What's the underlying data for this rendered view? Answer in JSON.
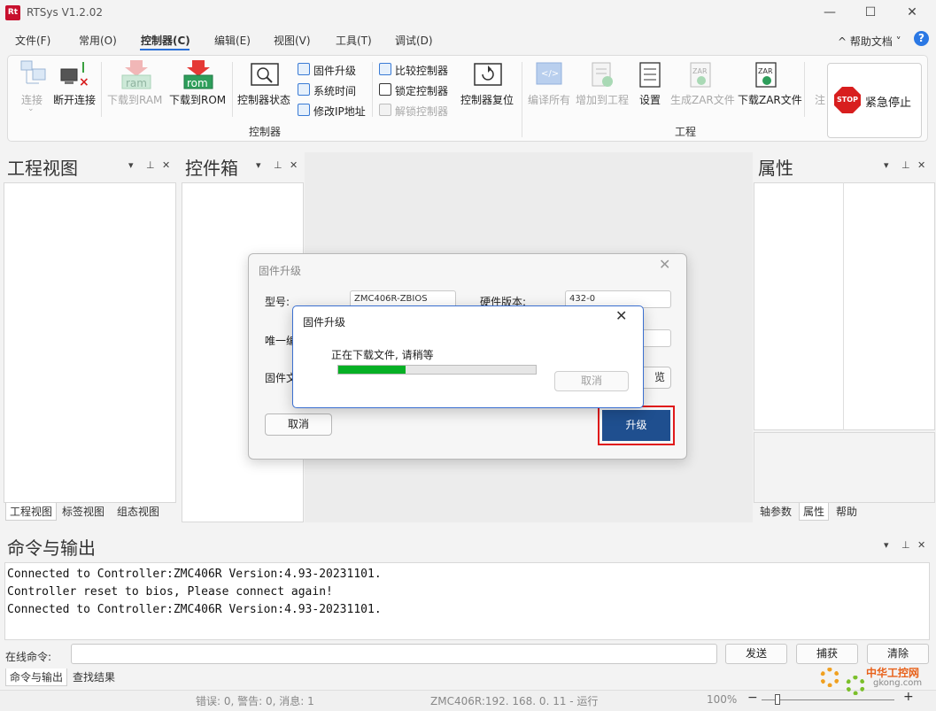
{
  "app": {
    "title": "RTSys V1.2.02",
    "logo_text": "Rt"
  },
  "window_controls": {
    "minimize": "—",
    "maximize": "☐",
    "close": "✕"
  },
  "menu": {
    "items": [
      "文件(F)",
      "常用(O)",
      "控制器(C)",
      "编辑(E)",
      "视图(V)",
      "工具(T)",
      "调试(D)"
    ],
    "help": "^  帮助文档  ˅",
    "help_icon": "?"
  },
  "ribbon": {
    "connect": "连接",
    "disconnect": "断开连接",
    "download_ram": "下载到RAM",
    "download_rom": "下载到ROM",
    "ram_icon_text": "ram",
    "rom_icon_text": "rom",
    "controller_status": "控制器状态",
    "firmware_upgrade": "固件升级",
    "system_time": "系统时间",
    "modify_ip": "修改IP地址",
    "compare_controller": "比较控制器",
    "lock_controller": "锁定控制器",
    "unlock_controller": "解锁控制器",
    "controller_reset": "控制器复位",
    "compile_all": "编译所有",
    "add_to_project": "增加到工程",
    "settings": "设置",
    "gen_zar": "生成ZAR文件",
    "download_zar": "下载ZAR文件",
    "zar_icon_text": "ZAR",
    "note_partial": "注",
    "group_controller": "控制器",
    "group_project": "工程"
  },
  "estop": {
    "icon_text": "STOP",
    "label": "紧急停止"
  },
  "panels": {
    "project_view": "工程视图",
    "toolbox": "控件箱",
    "properties": "属性",
    "panel_ctl_dropdown": "▾",
    "panel_ctl_pin": "⊥",
    "panel_ctl_close": "✕",
    "left_tabs": [
      "工程视图",
      "标签视图",
      "组态视图"
    ],
    "right_tabs": [
      "轴参数",
      "属性",
      "帮助"
    ]
  },
  "firmware_dialog": {
    "title": "固件升级",
    "model_label": "型号:",
    "model_value": "ZMC406R-ZBIOS",
    "hw_version_label": "硬件版本:",
    "hw_version_value": "432-0",
    "unique_label_partial": "唯一编",
    "file_label_partial": "固件文",
    "right_btn_partial": "览",
    "cancel": "取消",
    "upgrade": "升级"
  },
  "progress_dialog": {
    "title": "固件升级",
    "message": "正在下载文件, 请稍等",
    "progress": 0.34,
    "cancel": "取消"
  },
  "output": {
    "title": "命令与输出",
    "lines": [
      "Connected to Controller:ZMC406R Version:4.93-20231101.",
      "Controller reset to bios, Please connect again!",
      "Connected to Controller:ZMC406R Version:4.93-20231101."
    ],
    "cmd_label": "在线命令:",
    "send": "发送",
    "capture": "捕获",
    "clear": "清除",
    "tabs": [
      "命令与输出",
      "查找结果"
    ]
  },
  "status": {
    "messages": "错误: 0, 警告: 0, 消息: 1",
    "connection": "ZMC406R:192. 168. 0. 11 - 运行",
    "zoom": "100%",
    "zoom_minus": "−",
    "zoom_plus": "+"
  },
  "watermark": {
    "title": "中华工控网",
    "site": "gkong.com"
  }
}
